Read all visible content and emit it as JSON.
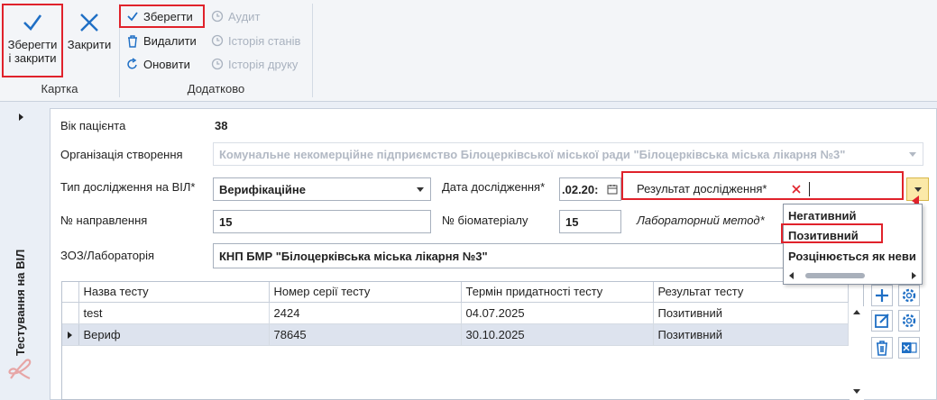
{
  "ribbon": {
    "save_close_line1": "Зберегти",
    "save_close_line2": "і закрити",
    "close": "Закрити",
    "card_group": "Картка",
    "save": "Зберегти",
    "delete": "Видалити",
    "refresh": "Оновити",
    "audit": "Аудит",
    "state_history": "Історія станів",
    "print_history": "Історія друку",
    "extra_group": "Додатково"
  },
  "side": {
    "tab_label": "Тестування на ВІЛ"
  },
  "form": {
    "age_label": "Вік пацієнта",
    "age_value": "38",
    "org_label": "Організація створення",
    "org_value": "Комунальне некомерційне підприємство Білоцерківської міської ради \"Білоцерківська міська лікарня №3\"",
    "test_type_label": "Тип дослідження на ВІЛ*",
    "test_type_value": "Верифікаційне",
    "date_label": "Дата дослідження*",
    "date_value": ".02.20:",
    "result_label": "Результат дослідження*",
    "direction_label": "№ направлення",
    "direction_value": "15",
    "biomaterial_label": "№ біоматеріалу",
    "biomaterial_value": "15",
    "lab_method_label": "Лабораторний метод*",
    "lab_label": "ЗОЗ/Лабораторія",
    "lab_value": "КНП БМР \"Білоцерківська міська лікарня №3\""
  },
  "grid": {
    "columns": [
      "Назва тесту",
      "Номер серії тесту",
      "Термін придатності тесту",
      "Результат тесту"
    ],
    "rows": [
      [
        "test",
        "2424",
        "04.07.2025",
        "Позитивний"
      ],
      [
        "Вериф",
        "78645",
        "30.10.2025",
        "Позитивний"
      ]
    ]
  },
  "dropdown": {
    "options": [
      "Негативний",
      "Позитивний",
      "Розцінюється як неви"
    ]
  },
  "colors": {
    "accent": "#1f6fc5",
    "highlight": "#e0222b"
  }
}
